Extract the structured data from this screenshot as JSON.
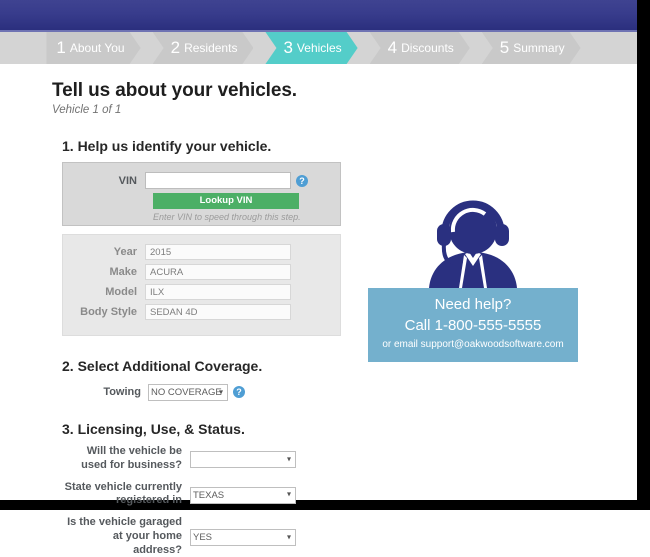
{
  "steps": [
    {
      "num": "1",
      "label": "About You",
      "active": false
    },
    {
      "num": "2",
      "label": "Residents",
      "active": false
    },
    {
      "num": "3",
      "label": "Vehicles",
      "active": true
    },
    {
      "num": "4",
      "label": "Discounts",
      "active": false
    },
    {
      "num": "5",
      "label": "Summary",
      "active": false
    }
  ],
  "page": {
    "title": "Tell us about your vehicles.",
    "subtitle": "Vehicle 1 of 1"
  },
  "section1": {
    "title": "1. Help us identify your vehicle.",
    "vin_label": "VIN",
    "vin_value": "",
    "vin_placeholder": "",
    "lookup_button": "Lookup VIN",
    "hint": "Enter VIN to speed through this step.",
    "help_icon": "question-mark-icon",
    "fields": [
      {
        "label": "Year",
        "value": "2015"
      },
      {
        "label": "Make",
        "value": "ACURA"
      },
      {
        "label": "Model",
        "value": "ILX"
      },
      {
        "label": "Body Style",
        "value": "SEDAN 4D"
      }
    ]
  },
  "help_card": {
    "icon": "support-agent-headset-icon",
    "line1": "Need help?",
    "line2": "Call 1-800-555-5555",
    "line3": "or email support@oakwoodsoftware.com"
  },
  "section2": {
    "title": "2. Select Additional Coverage.",
    "towing_label": "Towing",
    "towing_value": "NO COVERAGE",
    "towing_options": [
      "NO COVERAGE"
    ],
    "help_icon": "question-mark-icon"
  },
  "section3": {
    "title": "3. Licensing, Use, & Status.",
    "rows": [
      {
        "label": "Will the vehicle be used for business?",
        "value": "",
        "options": [
          ""
        ]
      },
      {
        "label": "State vehicle currently registered in",
        "value": "TEXAS",
        "options": [
          "TEXAS"
        ]
      },
      {
        "label": "Is the vehicle garaged at your home address?",
        "value": "YES",
        "options": [
          "YES"
        ]
      }
    ]
  },
  "colors": {
    "brand_bar": "#383c8c",
    "step_active": "#54cdc9",
    "step_inactive": "#c9c9c9",
    "lookup_button": "#4caf66",
    "help_card": "#74b0cd",
    "agent_icon": "#2a3080",
    "help_icon": "#4f9ed4"
  }
}
